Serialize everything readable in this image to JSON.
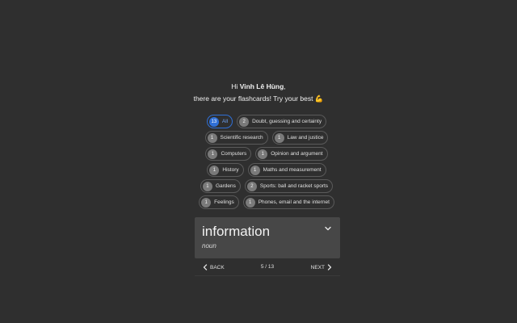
{
  "greeting": {
    "prefix": "Hi ",
    "name": "Vinh Lê Hùng",
    "suffix": ",",
    "line2": "there are your flashcards! Try your best ",
    "emoji": "💪"
  },
  "categories": [
    {
      "count": "13",
      "label": "All",
      "active": true
    },
    {
      "count": "2",
      "label": "Doubt, guessing and certainty"
    },
    {
      "count": "1",
      "label": "Scientific research"
    },
    {
      "count": "1",
      "label": "Law and justice"
    },
    {
      "count": "1",
      "label": "Computers"
    },
    {
      "count": "1",
      "label": "Opinion and argument"
    },
    {
      "count": "1",
      "label": "History"
    },
    {
      "count": "1",
      "label": "Maths and measurement"
    },
    {
      "count": "1",
      "label": "Gardens"
    },
    {
      "count": "2",
      "label": "Sports: ball and racket sports"
    },
    {
      "count": "1",
      "label": "Feelings"
    },
    {
      "count": "1",
      "label": "Phones, email and the internet"
    }
  ],
  "card": {
    "word": "information",
    "part_of_speech": "noun",
    "expand_icon": "chevron-down-icon"
  },
  "nav": {
    "back_label": "BACK",
    "next_label": "NEXT",
    "pager": "5 / 13",
    "back_icon": "chevron-left-icon",
    "next_icon": "chevron-right-icon"
  },
  "colors": {
    "background": "#2f2f2f",
    "card": "#474747",
    "accent": "#2f6fd6",
    "chip_border": "#5a5a5a"
  }
}
